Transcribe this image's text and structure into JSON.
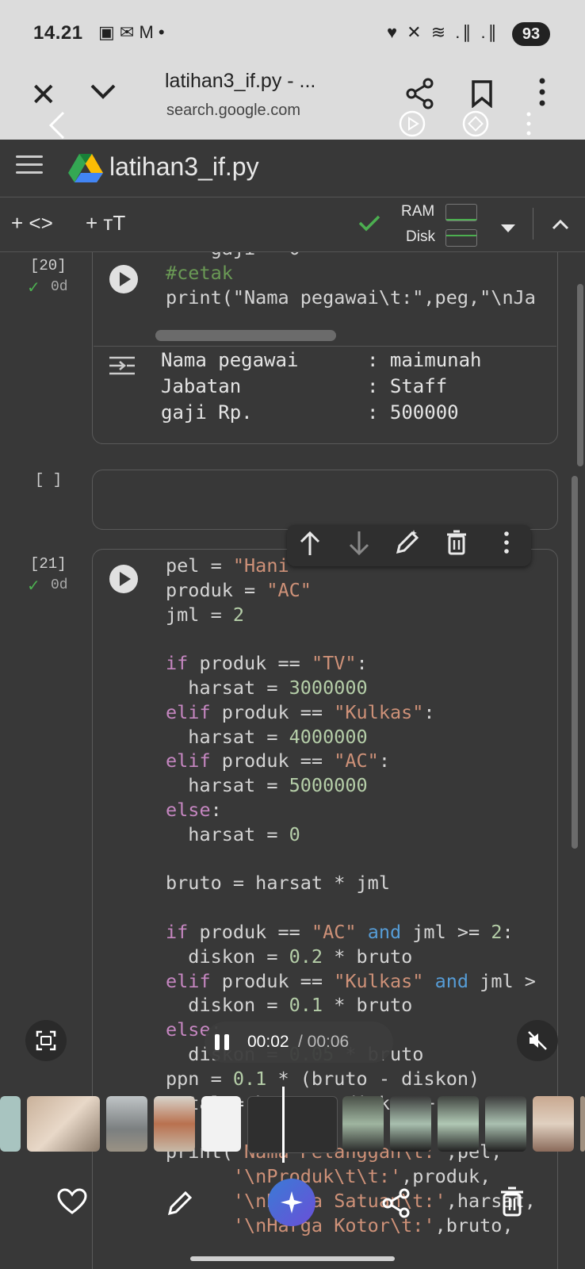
{
  "status_bar": {
    "time": "14.21",
    "left_icons": "▣ ✉ M •",
    "right_icons": "♥ ✕ ≋ .∥ .∥",
    "battery": "93"
  },
  "browser": {
    "title": "latihan3_if.py - ...",
    "url": "search.google.com",
    "icons": [
      "close-icon",
      "chevron-down-icon",
      "share-icon",
      "bookmark-icon",
      "more-vert-icon"
    ]
  },
  "colab": {
    "file_name": "latihan3_if.py",
    "toolbar": {
      "add_code": "+ <>",
      "add_text": "+ тT",
      "ram_label": "RAM",
      "disk_label": "Disk"
    }
  },
  "cells": {
    "cell20": {
      "exec_count": "[20]",
      "status": "0d",
      "code_tail": [
        "    gaji = 0",
        "#cetak",
        "print(\"Nama pegawai\\t:\",peg,\"\\nJa"
      ],
      "output": [
        {
          "label": "Nama pegawai",
          "value": ": maimunah"
        },
        {
          "label": "Jabatan",
          "value": ": Staff"
        },
        {
          "label": "gaji Rp.",
          "value": ": 500000"
        }
      ]
    },
    "empty_cell": {
      "exec_count": "[ ]"
    },
    "cell21": {
      "exec_count": "[21]",
      "status": "0d"
    }
  },
  "overlay": {
    "video_time": "00:02",
    "video_duration": "/ 00:06"
  }
}
